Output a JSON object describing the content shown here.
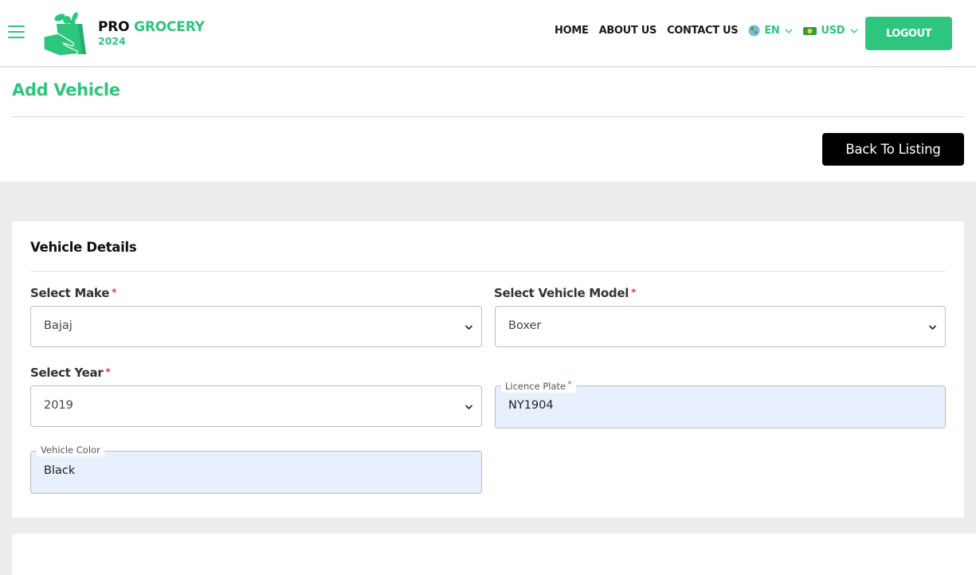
{
  "header": {
    "menu_icon": "hamburger-menu-icon",
    "logo": {
      "brand_first": "PRO",
      "brand_second": "GROCERY",
      "year": "2024",
      "icon": "grocery-bag-hand-icon"
    },
    "nav": [
      {
        "label": "HOME"
      },
      {
        "label": "ABOUT US"
      },
      {
        "label": "CONTACT US"
      }
    ],
    "language": {
      "label": "EN",
      "icon": "globe-icon"
    },
    "currency": {
      "label": "USD",
      "icon": "money-bill-icon"
    },
    "logout_label": "LOGOUT"
  },
  "page": {
    "title": "Add Vehicle",
    "back_button_label": "Back To Listing"
  },
  "form": {
    "section_title": "Vehicle Details",
    "fields": {
      "make": {
        "label": "Select Make",
        "required": "*",
        "value": "Bajaj"
      },
      "model": {
        "label": "Select Vehicle Model",
        "required": "*",
        "value": "Boxer"
      },
      "year": {
        "label": "Select Year",
        "required": "*",
        "value": "2019"
      },
      "licence_plate": {
        "label": "Licence Plate",
        "required": "*",
        "value": "NY1904"
      },
      "color": {
        "label": "Vehicle Color",
        "value": "Black"
      }
    }
  },
  "colors": {
    "brand_green": "#2ec57e",
    "required_red": "#e53e3e",
    "autofill_bg": "#e8f0fe",
    "page_bg": "#ededed"
  }
}
